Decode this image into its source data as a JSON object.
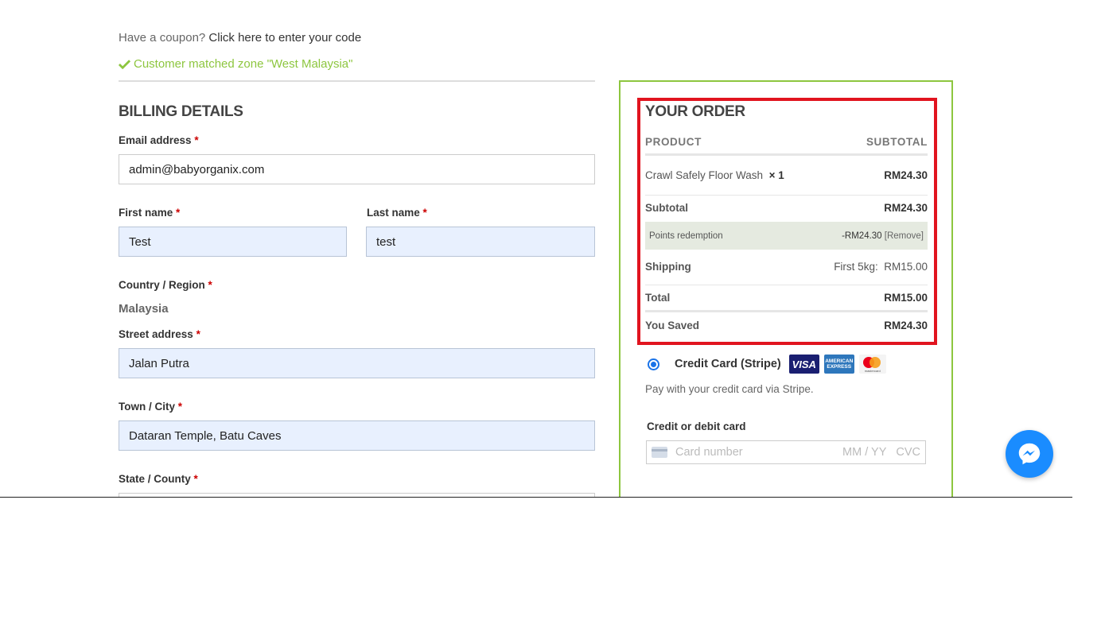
{
  "coupon": {
    "prompt": "Have a coupon?",
    "link": "Click here to enter your code"
  },
  "zone_message": "Customer matched zone \"West Malaysia\"",
  "billing": {
    "title": "BILLING DETAILS",
    "required_mark": "*",
    "email": {
      "label": "Email address",
      "value": "admin@babyorganix.com"
    },
    "first_name": {
      "label": "First name",
      "value": "Test"
    },
    "last_name": {
      "label": "Last name",
      "value": "test"
    },
    "country": {
      "label": "Country / Region",
      "value": "Malaysia"
    },
    "street": {
      "label": "Street address",
      "value": "Jalan Putra"
    },
    "town": {
      "label": "Town / City",
      "value": "Dataran Temple, Batu Caves"
    },
    "state": {
      "label": "State / County",
      "value": ""
    }
  },
  "order": {
    "title": "YOUR ORDER",
    "head_product": "PRODUCT",
    "head_subtotal": "SUBTOTAL",
    "item": {
      "name": "Crawl Safely Floor Wash",
      "qty": "× 1",
      "price": "RM24.30"
    },
    "subtotal": {
      "label": "Subtotal",
      "value": "RM24.30"
    },
    "points": {
      "label": "Points redemption",
      "value": "-RM24.30",
      "remove": "[Remove]"
    },
    "shipping": {
      "label": "Shipping",
      "method": "First 5kg:",
      "value": "RM15.00"
    },
    "total": {
      "label": "Total",
      "value": "RM15.00"
    },
    "saved": {
      "label": "You Saved",
      "value": "RM24.30"
    }
  },
  "payment": {
    "method_label": "Credit Card (Stripe)",
    "visa": "VISA",
    "amex_line1": "AMERICAN",
    "amex_line2": "EXPRESS",
    "mc_text": "mastercard",
    "description": "Pay with your credit card via Stripe.",
    "card_label": "Credit or debit card",
    "card_number_placeholder": "Card number",
    "expiry_placeholder": "MM / YY",
    "cvc_placeholder": "CVC"
  },
  "colors": {
    "accent_green": "#8dc63f",
    "highlight_red": "#e1141f",
    "messenger_blue": "#1a8cff"
  }
}
